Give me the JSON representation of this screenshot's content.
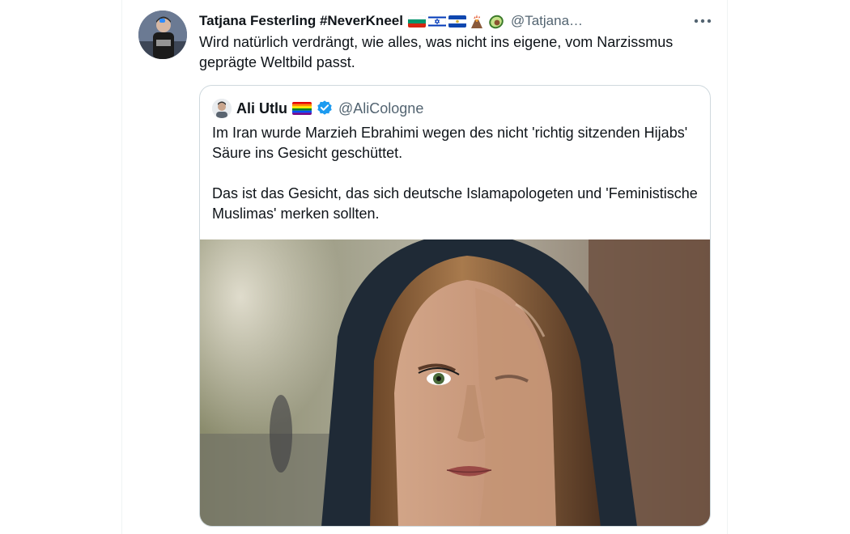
{
  "tweet": {
    "author_name": "Tatjana Festerling #NeverKneel",
    "author_handle": "@Tatjana…",
    "author_emojis": [
      "bulgaria-flag-icon",
      "israel-flag-icon",
      "el-salvador-flag-icon",
      "volcano-icon",
      "avocado-icon"
    ],
    "text": "Wird natürlich verdrängt, wie alles, was nicht ins eigene, vom Narzissmus geprägte Weltbild passt."
  },
  "quoted_tweet": {
    "author_name": "Ali Utlu",
    "author_handle": "@AliCologne",
    "verified": true,
    "paragraphs": [
      "Im Iran wurde Marzieh Ebrahimi wegen des nicht 'richtig sitzenden Hijabs' Säure ins Gesicht geschüttet.",
      "Das ist das Gesicht, das sich deutsche Islamapologeten und 'Feministische Muslimas' merken sollten."
    ],
    "image_icon": "portrait-photo"
  },
  "colors": {
    "text": "#0f1419",
    "secondary_text": "#536471",
    "border": "#cfd9de",
    "verified_blue": "#1d9bf0"
  }
}
